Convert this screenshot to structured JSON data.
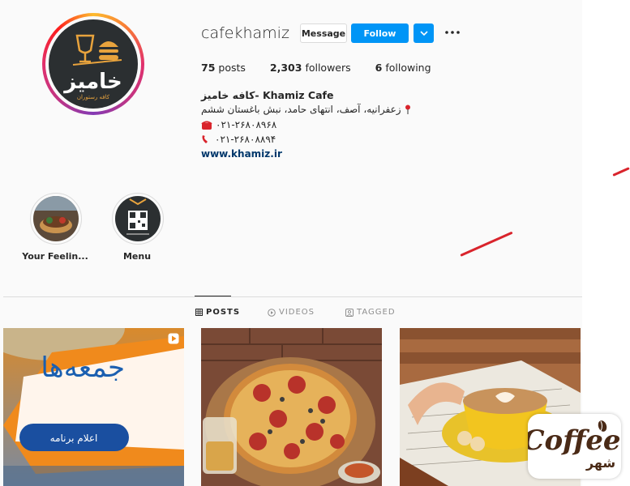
{
  "profile": {
    "username": "cafekhamiz",
    "avatar_text": "خامیز",
    "avatar_subtext": "کافه رستوران",
    "buttons": {
      "message": "Message",
      "follow": "Follow",
      "dropdown_icon": "chevron-down-icon",
      "more_icon": "more-options-icon"
    },
    "stats": [
      {
        "count": "75",
        "label": "posts"
      },
      {
        "count": "2,303",
        "label": "followers"
      },
      {
        "count": "6",
        "label": "following"
      }
    ],
    "bio": {
      "name": "کافه خامیز- Khamiz Cafe",
      "address": "زعفرانیه، آصف، انتهای حامد، نبش باغستان ششم",
      "phone1": "۰۲۱-۲۶۸۰۸۹۶۸",
      "phone2": "۰۲۱-۲۶۸۰۸۸۹۴",
      "link": "www.khamiz.ir"
    }
  },
  "highlights": [
    {
      "label": "Your Feelin..."
    },
    {
      "label": "Menu"
    }
  ],
  "tabs": [
    {
      "label": "POSTS",
      "icon": "grid-icon",
      "active": true
    },
    {
      "label": "VIDEOS",
      "icon": "video-icon",
      "active": false
    },
    {
      "label": "TAGGED",
      "icon": "tag-icon",
      "active": false
    }
  ],
  "posts": [
    {
      "kind": "video",
      "overlay_text": "جمعه‌ها",
      "badge_text": "اعلام برنامه"
    },
    {
      "kind": "image",
      "subject": "pizza"
    },
    {
      "kind": "image",
      "subject": "coffee"
    }
  ],
  "watermark": {
    "text_en": "Coffee",
    "text_fa": "شهر"
  },
  "colors": {
    "follow_blue": "#0095f6",
    "link_blue": "#00376b",
    "annotation_red": "#d9242c"
  }
}
